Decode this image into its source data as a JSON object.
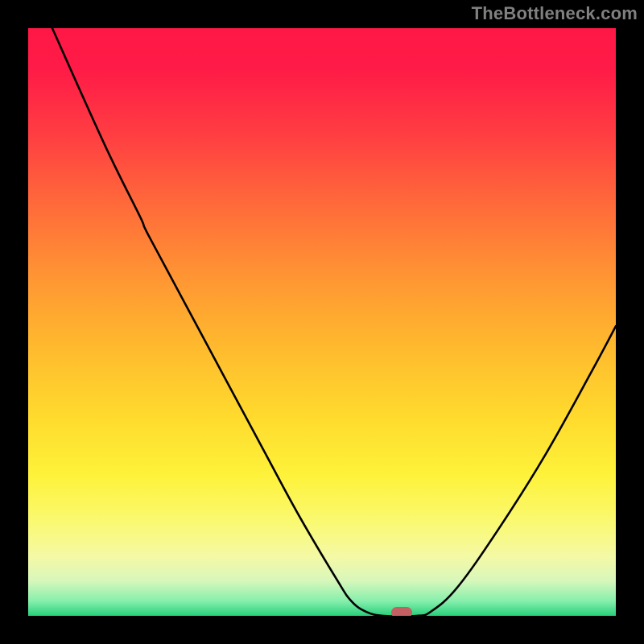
{
  "attribution": "TheBottleneck.com",
  "chart_data": {
    "type": "line",
    "title": "",
    "xlabel": "",
    "ylabel": "",
    "x_range": [
      0,
      100
    ],
    "y_range": [
      0,
      100
    ],
    "curve_points": [
      [
        4.1,
        100.0
      ],
      [
        13.0,
        80.2
      ],
      [
        19.0,
        68.0
      ],
      [
        20.5,
        64.7
      ],
      [
        28.0,
        50.7
      ],
      [
        40.0,
        28.3
      ],
      [
        46.0,
        17.2
      ],
      [
        52.5,
        6.2
      ],
      [
        55.0,
        2.5
      ],
      [
        57.5,
        0.7
      ],
      [
        60.5,
        0.0
      ],
      [
        66.0,
        0.0
      ],
      [
        68.5,
        0.7
      ],
      [
        73.0,
        4.8
      ],
      [
        80.0,
        14.7
      ],
      [
        88.0,
        27.4
      ],
      [
        96.0,
        41.8
      ],
      [
        100.0,
        49.3
      ]
    ],
    "marker": {
      "x": 63.5,
      "y": 0.0
    },
    "colors": {
      "top": "#ff1846",
      "orange": "#ff9433",
      "yellow": "#ffda2d",
      "pale": "#f4f9a6",
      "green": "#27d07b",
      "marker": "#c26063",
      "curve": "#000000"
    }
  }
}
